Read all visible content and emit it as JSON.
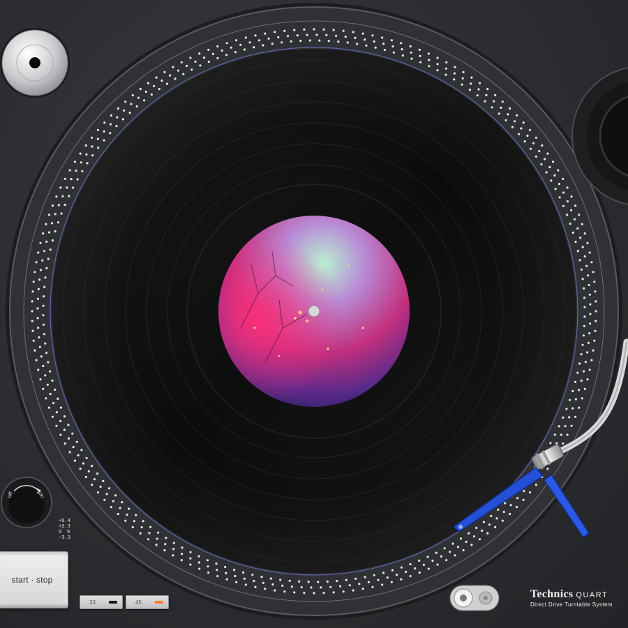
{
  "controls": {
    "start_stop_label": "start · stop",
    "power_off_label": "off",
    "power_on_label": "on",
    "speed_33_label": "33",
    "speed_45_label": "45",
    "speed_45_led_color": "#ff7a2a",
    "speed_33_led_color": "#1a1a1a"
  },
  "pitch": {
    "values": [
      "+6.4",
      "+3.3",
      "0",
      "-3.3"
    ],
    "unit": "%"
  },
  "brand": {
    "name": "Technics",
    "name_suffix": "QUART",
    "subtitle": "Direct Drive Turntable System"
  },
  "icons": {
    "power_dial": "power-dial-icon",
    "target_light": "target-light-icon",
    "tonearm": "tonearm-icon",
    "headshell": "headshell-icon"
  },
  "colors": {
    "chassis": "#2c2d30",
    "vinyl": "#0b0b0c",
    "headshell": "#2450d8",
    "platter_dots": "#e6e6e6"
  }
}
